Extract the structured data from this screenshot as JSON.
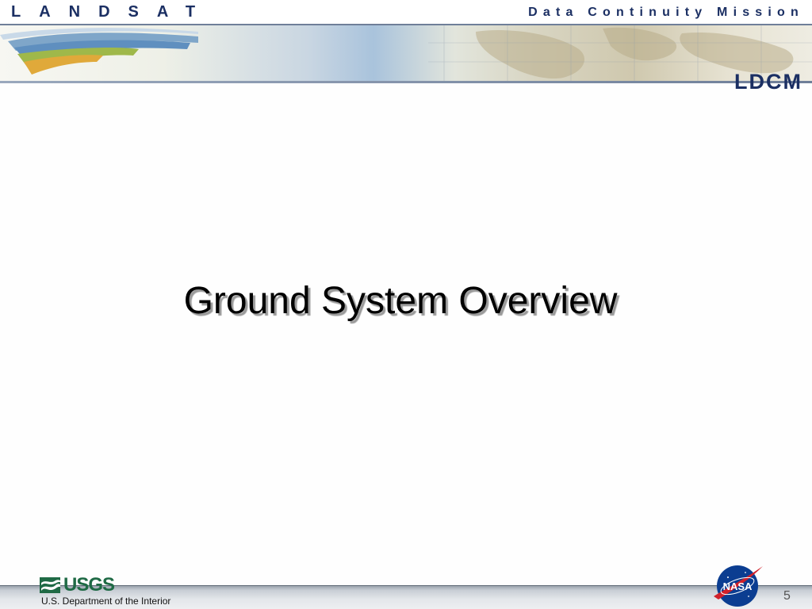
{
  "header": {
    "brand_left": "LANDSAT",
    "brand_right": "Data Continuity Mission",
    "logo_text": "LDCM"
  },
  "slide": {
    "title": "Ground System Overview",
    "page_number": "5"
  },
  "footer": {
    "usgs_label": "USGS",
    "department": "U.S. Department of the Interior",
    "nasa_label": "NASA"
  },
  "colors": {
    "brand_navy": "#1b2f63",
    "usgs_green": "#1f6a45",
    "nasa_blue": "#0b3d91",
    "nasa_red": "#d0202a"
  }
}
